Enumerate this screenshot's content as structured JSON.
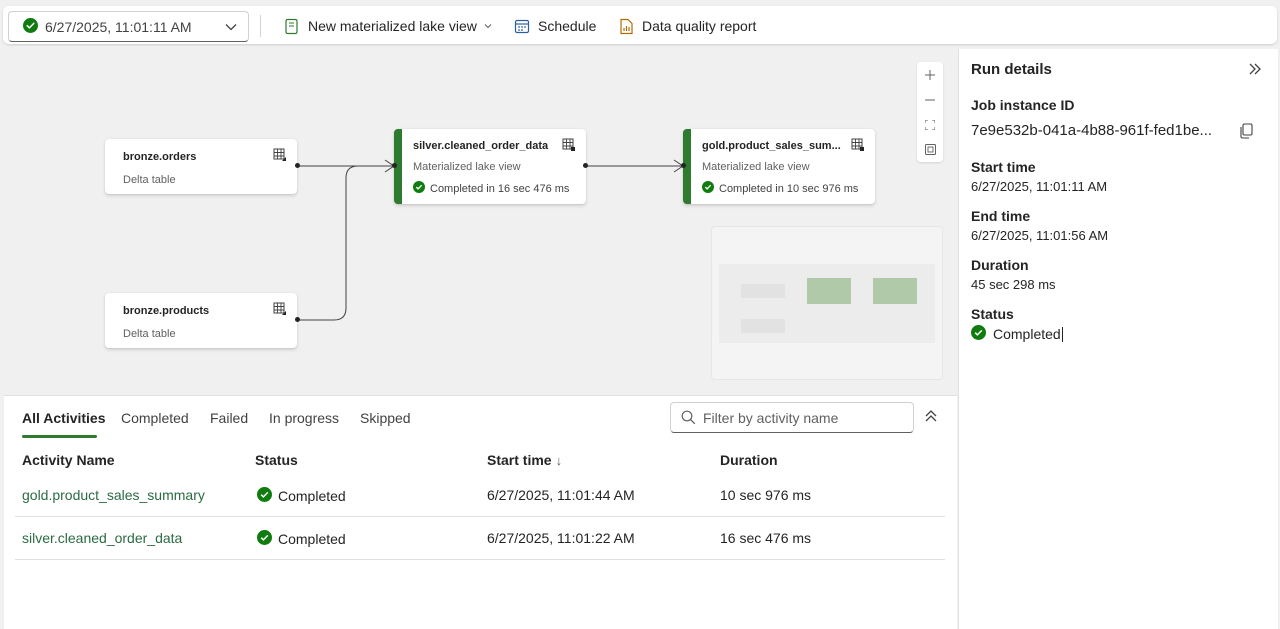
{
  "toolbar": {
    "run_value": "6/27/2025, 11:01:11 AM",
    "new_view_label": "New materialized lake view",
    "schedule_label": "Schedule",
    "dq_report_label": "Data quality report"
  },
  "colors": {
    "accent_green": "#2e7a2e",
    "link_green": "#2b6b43",
    "success_green": "#107c10"
  },
  "lineage": {
    "nodes": [
      {
        "title": "bronze.orders",
        "subtitle": "Delta table"
      },
      {
        "title": "bronze.products",
        "subtitle": "Delta table"
      },
      {
        "title": "silver.cleaned_order_data",
        "subtitle": "Materialized lake view",
        "status": "Completed in 16 sec 476 ms"
      },
      {
        "title": "gold.product_sales_sum...",
        "subtitle": "Materialized lake view",
        "status": "Completed in 10 sec 976 ms"
      }
    ]
  },
  "run_details": {
    "title": "Run details",
    "job_id_label": "Job instance ID",
    "job_id": "7e9e532b-041a-4b88-961f-fed1be...",
    "start_label": "Start time",
    "start_value": "6/27/2025, 11:01:11 AM",
    "end_label": "End time",
    "end_value": "6/27/2025, 11:01:56 AM",
    "duration_label": "Duration",
    "duration_value": "45 sec 298 ms",
    "status_label": "Status",
    "status_value": "Completed"
  },
  "activities": {
    "tabs": [
      "All Activities",
      "Completed",
      "Failed",
      "In progress",
      "Skipped"
    ],
    "filter_placeholder": "Filter by activity name",
    "columns": [
      "Activity Name",
      "Status",
      "Start time",
      "Duration"
    ],
    "sort_indicator": "↓",
    "rows": [
      {
        "name": "gold.product_sales_summary",
        "status": "Completed",
        "start": "6/27/2025, 11:01:44 AM",
        "duration": "10 sec 976 ms"
      },
      {
        "name": "silver.cleaned_order_data",
        "status": "Completed",
        "start": "6/27/2025, 11:01:22 AM",
        "duration": "16 sec 476 ms"
      }
    ]
  }
}
